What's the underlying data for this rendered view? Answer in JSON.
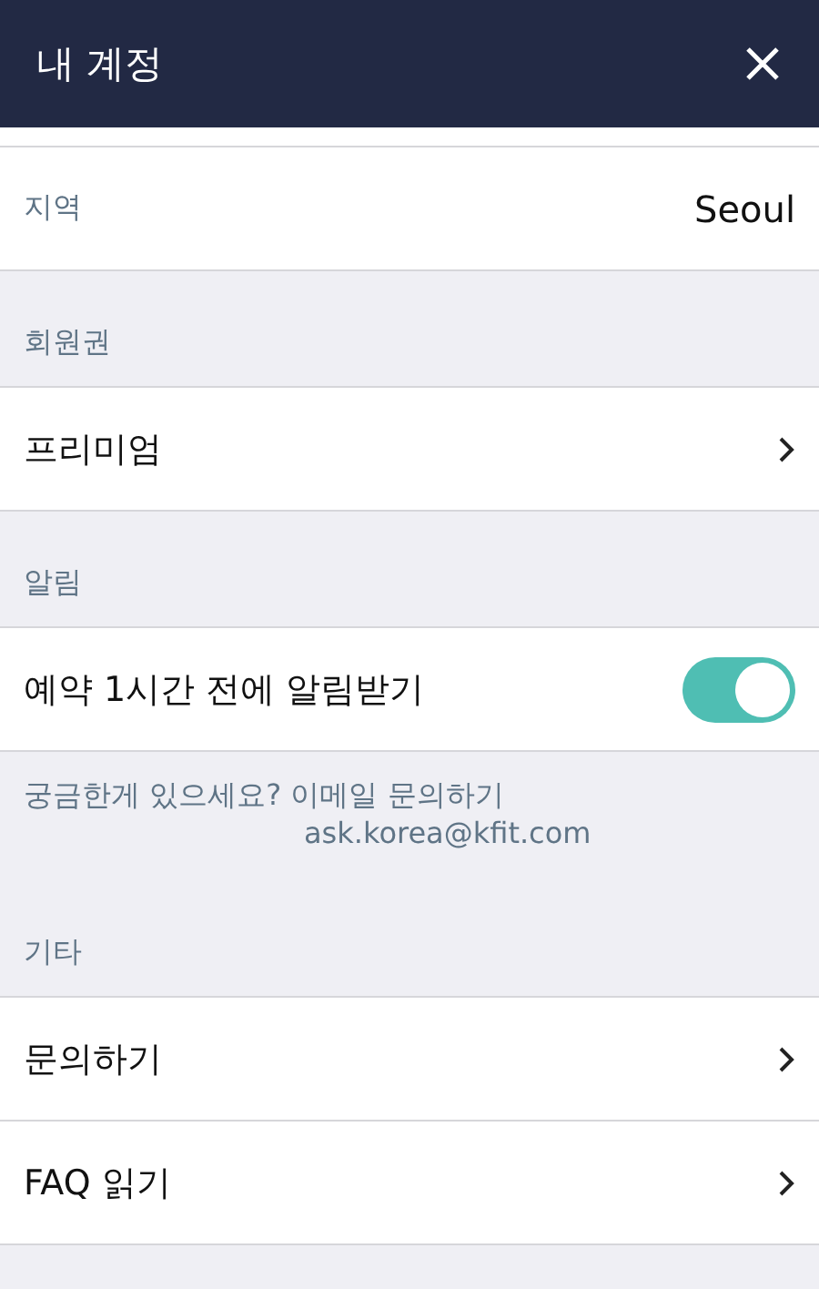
{
  "header": {
    "title": "내 계정"
  },
  "region": {
    "label": "지역",
    "value": "Seoul"
  },
  "sections": [
    {
      "title": "회원권",
      "rows": [
        {
          "kind": "link",
          "label": "프리미엄"
        }
      ]
    },
    {
      "title": "알림",
      "rows": [
        {
          "kind": "toggle",
          "label": "예약 1시간 전에 알림받기",
          "on": true
        }
      ],
      "help": {
        "question": "궁금한게 있으세요? 이메일 문의하기",
        "email": "ask.korea@kfit.com"
      }
    },
    {
      "title": "기타",
      "rows": [
        {
          "kind": "link",
          "label": "문의하기"
        },
        {
          "kind": "link",
          "label": "FAQ 읽기"
        }
      ]
    }
  ]
}
